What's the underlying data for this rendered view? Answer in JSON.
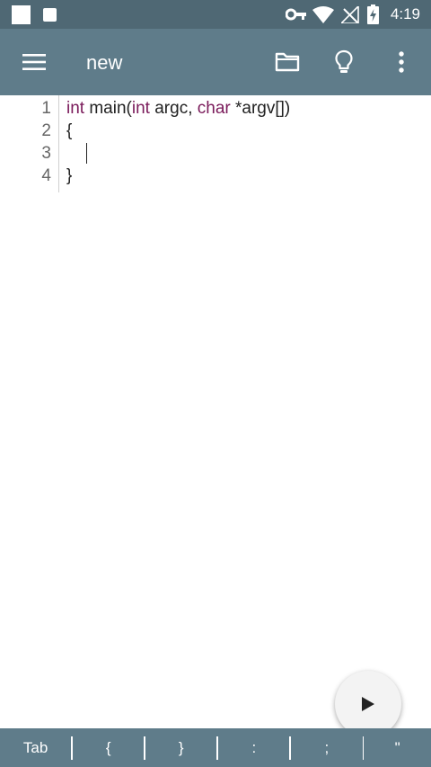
{
  "status_bar": {
    "time": "4:19",
    "icons": [
      "app-notification-icon",
      "notification-icon",
      "vpn-key-icon",
      "wifi-icon",
      "no-signal-icon",
      "battery-charging-icon"
    ]
  },
  "app_bar": {
    "title": "new",
    "icons": [
      "menu-icon",
      "folder-icon",
      "lightbulb-icon",
      "more-vert-icon"
    ]
  },
  "editor": {
    "line_numbers": [
      "1",
      "2",
      "3",
      "4"
    ],
    "line1": {
      "kw_int1": "int",
      "t_main": " main(",
      "kw_int2": "int",
      "t_argc": " argc, ",
      "kw_char": "char",
      "t_argv": " *argv[])"
    },
    "line2": "{",
    "line3": "",
    "line4": "}",
    "keyword_color": "#7a1a5a"
  },
  "fab": {
    "icon": "play-icon"
  },
  "symbol_bar": {
    "keys": [
      "Tab",
      "{",
      "}",
      ":",
      ";",
      "\""
    ]
  },
  "colors": {
    "app_bar": "#5f7c8a",
    "status_bar": "#4f6874"
  }
}
